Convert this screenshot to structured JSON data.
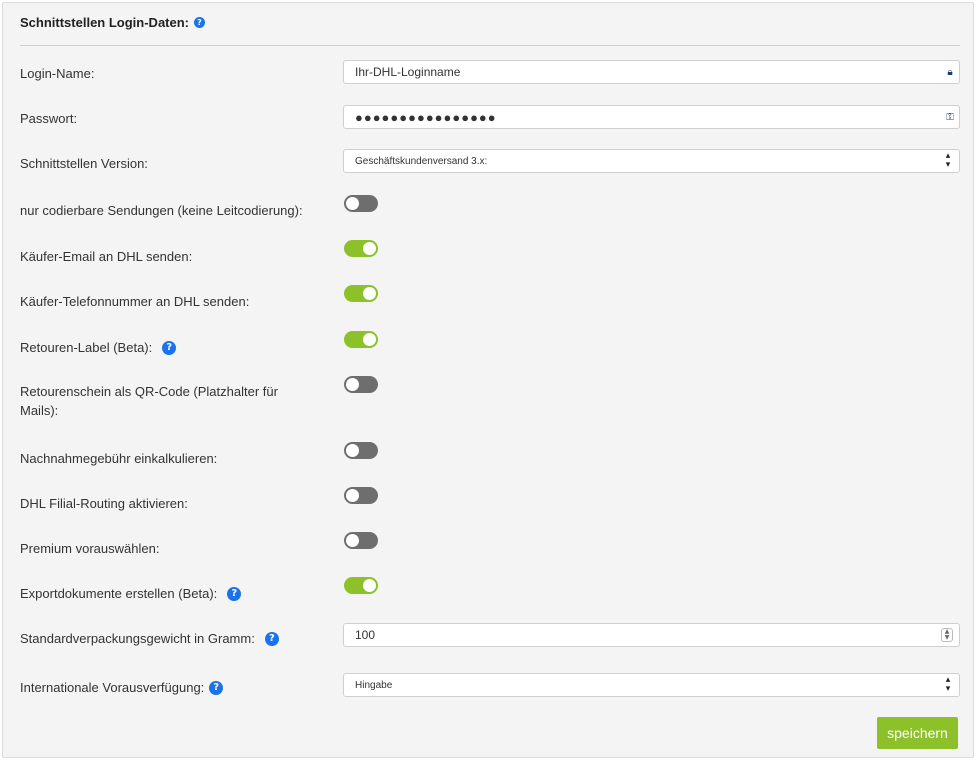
{
  "panel": {
    "title": "Schnittstellen Login-Daten:",
    "help_icon": "question-circle-icon"
  },
  "fields": {
    "login": {
      "label": "Login-Name:",
      "value": "Ihr-DHL-Loginname",
      "icon": "lock-icon"
    },
    "password": {
      "label": "Passwort:",
      "value": "●●●●●●●●●●●●●●●●",
      "icon": "key-icon"
    },
    "version": {
      "label": "Schnittstellen Version:",
      "value": "Geschäftskundenversand 3.x:"
    },
    "weight": {
      "label": "Standardverpackungsgewicht in Gramm:",
      "value": "100"
    },
    "intl": {
      "label": "Internationale Vorausverfügung:",
      "value": "Hingabe"
    }
  },
  "toggles": {
    "codable": {
      "label": "nur codierbare Sendungen (keine Leitcodierung):",
      "on": false
    },
    "email": {
      "label": "Käufer-Email an DHL senden:",
      "on": true
    },
    "phone": {
      "label": "Käufer-Telefonnummer an DHL senden:",
      "on": true
    },
    "return_label": {
      "label": "Retouren-Label (Beta):",
      "on": true
    },
    "qr_line1": "Retourenschein als QR-Code (Platzhalter für",
    "qr_line2": "Mails):",
    "qr": {
      "on": false
    },
    "cod": {
      "label": "Nachnahmegebühr einkalkulieren:",
      "on": false
    },
    "routing": {
      "label": "DHL Filial-Routing aktivieren:",
      "on": false
    },
    "premium": {
      "label": "Premium vorauswählen:",
      "on": false
    },
    "export": {
      "label": "Exportdokumente erstellen (Beta):",
      "on": true
    }
  },
  "colors": {
    "accent": "#8cc12a",
    "toggle_off": "#6e6e6e",
    "help": "#1a73e8"
  },
  "actions": {
    "save_label": "speichern"
  }
}
